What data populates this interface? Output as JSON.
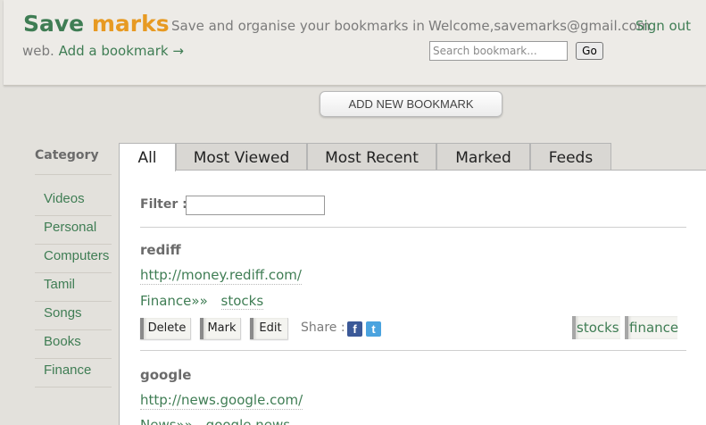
{
  "header": {
    "logo_part1": "Save",
    "logo_part2": "marks",
    "tagline_line1": "Save and organise your bookmarks in",
    "tagline_line2": "web.",
    "add_bookmark_link": "Add a bookmark →",
    "welcome_text": "Welcome,savemarks@gmail.com",
    "sign_out": "Sign out",
    "search_placeholder": "Search bookmark...",
    "search_button": "Go"
  },
  "add_new_button": "ADD NEW BOOKMARK",
  "sidebar": {
    "title": "Category",
    "items": [
      "Videos",
      "Personal",
      "Computers",
      "Tamil",
      "Songs",
      "Books",
      "Finance"
    ]
  },
  "tabs": [
    "All",
    "Most Viewed",
    "Most Recent",
    "Marked",
    "Feeds"
  ],
  "active_tab": "All",
  "filter_label": "Filter :",
  "bookmarks": [
    {
      "title": "rediff",
      "url": "http://money.rediff.com/",
      "category": "Finance»»",
      "subcategory": "stocks",
      "tags": [
        "stocks",
        "finance"
      ]
    },
    {
      "title": "google",
      "url": "http://news.google.com/",
      "category": "News»»",
      "subcategory": "google news"
    }
  ],
  "actions": {
    "delete": "Delete",
    "mark": "Mark",
    "edit": "Edit",
    "share": "Share :"
  },
  "colors": {
    "brand_green": "#3f7d54",
    "brand_orange": "#e79a22",
    "background": "#e3e1dc"
  },
  "icons": {
    "facebook": "facebook-icon",
    "twitter": "twitter-icon"
  }
}
